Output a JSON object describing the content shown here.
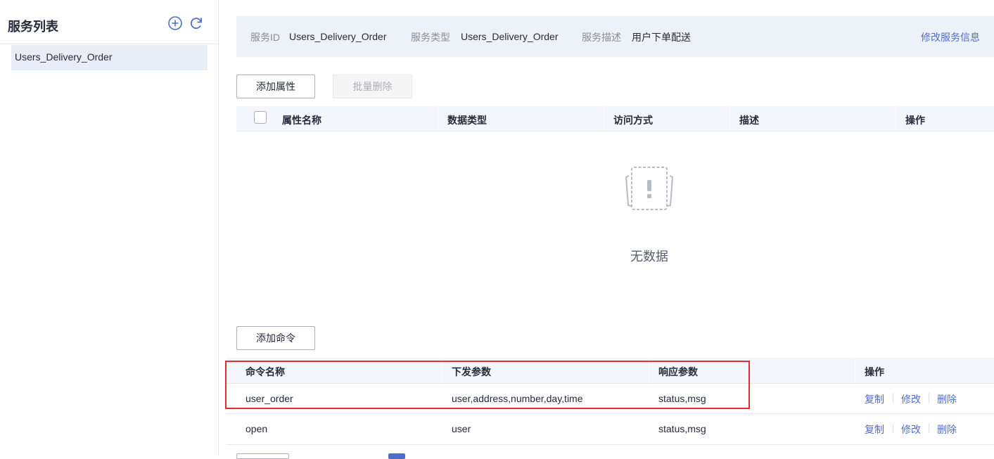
{
  "sidebar": {
    "title": "服务列表",
    "services": [
      {
        "label": "Users_Delivery_Order"
      }
    ]
  },
  "info": {
    "service_id_label": "服务ID",
    "service_id_value": "Users_Delivery_Order",
    "service_type_label": "服务类型",
    "service_type_value": "Users_Delivery_Order",
    "service_desc_label": "服务描述",
    "service_desc_value": "用户下单配送",
    "edit_link": "修改服务信息"
  },
  "properties": {
    "add_button": "添加属性",
    "batch_delete_button": "批量删除",
    "headers": [
      "属性名称",
      "数据类型",
      "访问方式",
      "描述",
      "操作"
    ],
    "empty_text": "无数据"
  },
  "commands": {
    "add_button": "添加命令",
    "headers": [
      "命令名称",
      "下发参数",
      "响应参数",
      "操作"
    ],
    "rows": [
      {
        "name": "user_order",
        "params": "user,address,number,day,time",
        "response": "status,msg",
        "actions": [
          "复制",
          "修改",
          "删除"
        ]
      },
      {
        "name": "open",
        "params": "user",
        "response": "status,msg",
        "actions": [
          "复制",
          "修改",
          "删除"
        ]
      }
    ]
  },
  "colors": {
    "accent": "#526ecc",
    "highlight": "#e02f2f",
    "header_bg": "#f3f6fc",
    "selected_bg": "#e8edf7"
  },
  "icons": {
    "add": "plus-circle-icon",
    "refresh": "refresh-icon",
    "empty": "empty-data-icon"
  }
}
